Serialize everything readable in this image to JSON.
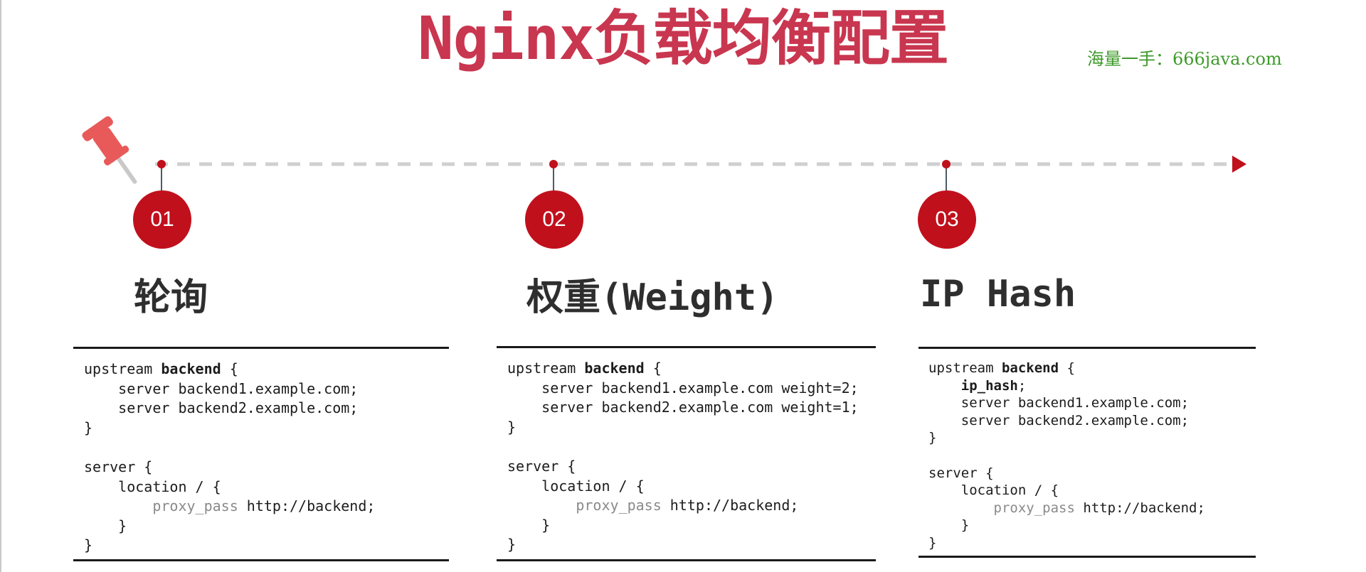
{
  "title": "Nginx负载均衡配置",
  "watermark": "海量一手：666java.com",
  "colors": {
    "title": "#c9364f",
    "watermark": "#3e9a2a",
    "accent": "#c0101c",
    "timeline": "#cfcfcf",
    "pin": "#e85a5a"
  },
  "icons": {
    "pin": "pushpin-icon",
    "arrow": "arrow-right-icon"
  },
  "steps": [
    {
      "number": "01",
      "title": "轮询",
      "code": [
        [
          {
            "t": "upstream "
          },
          {
            "t": "backend",
            "s": "bold"
          },
          {
            "t": " {"
          }
        ],
        [
          {
            "t": "    server backend1.example.com;"
          }
        ],
        [
          {
            "t": "    server backend2.example.com;"
          }
        ],
        [
          {
            "t": "}"
          }
        ],
        [
          {
            "t": ""
          }
        ],
        [
          {
            "t": "server {"
          }
        ],
        [
          {
            "t": "    location / {"
          }
        ],
        [
          {
            "t": "        "
          },
          {
            "t": "proxy_pass",
            "s": "muted"
          },
          {
            "t": " http://backend;"
          }
        ],
        [
          {
            "t": "    }"
          }
        ],
        [
          {
            "t": "}"
          }
        ]
      ]
    },
    {
      "number": "02",
      "title": "权重(Weight)",
      "code": [
        [
          {
            "t": "upstream "
          },
          {
            "t": "backend",
            "s": "bold"
          },
          {
            "t": " {"
          }
        ],
        [
          {
            "t": "    server backend1.example.com weight=2;"
          }
        ],
        [
          {
            "t": "    server backend2.example.com weight=1;"
          }
        ],
        [
          {
            "t": "}"
          }
        ],
        [
          {
            "t": ""
          }
        ],
        [
          {
            "t": "server {"
          }
        ],
        [
          {
            "t": "    location / {"
          }
        ],
        [
          {
            "t": "        "
          },
          {
            "t": "proxy_pass",
            "s": "muted"
          },
          {
            "t": " http://backend;"
          }
        ],
        [
          {
            "t": "    }"
          }
        ],
        [
          {
            "t": "}"
          }
        ]
      ]
    },
    {
      "number": "03",
      "title": "IP Hash",
      "code": [
        [
          {
            "t": "upstream "
          },
          {
            "t": "backend",
            "s": "bold"
          },
          {
            "t": " {"
          }
        ],
        [
          {
            "t": "    "
          },
          {
            "t": "ip_hash",
            "s": "bold"
          },
          {
            "t": ";"
          }
        ],
        [
          {
            "t": "    server backend1.example.com;"
          }
        ],
        [
          {
            "t": "    server backend2.example.com;"
          }
        ],
        [
          {
            "t": "}"
          }
        ],
        [
          {
            "t": ""
          }
        ],
        [
          {
            "t": "server {"
          }
        ],
        [
          {
            "t": "    location / {"
          }
        ],
        [
          {
            "t": "        "
          },
          {
            "t": "proxy_pass",
            "s": "muted"
          },
          {
            "t": " http://backend;"
          }
        ],
        [
          {
            "t": "    }"
          }
        ],
        [
          {
            "t": "}"
          }
        ]
      ]
    }
  ]
}
